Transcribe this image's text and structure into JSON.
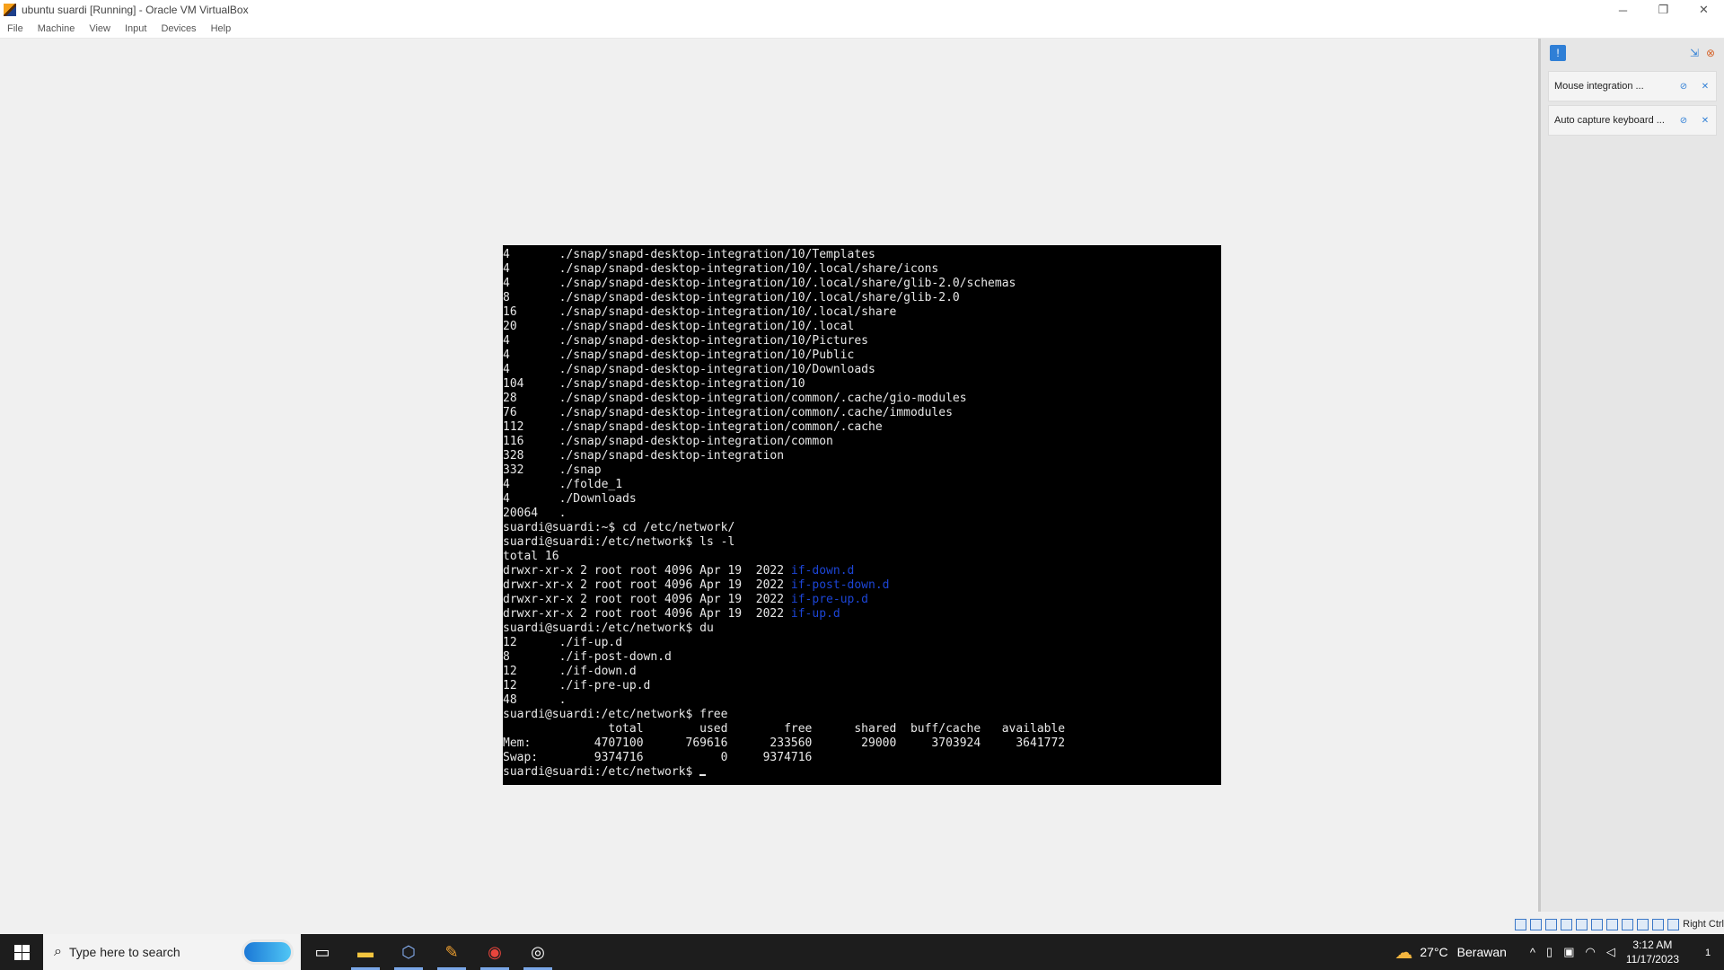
{
  "window": {
    "title": "ubuntu suardi [Running] - Oracle VM VirtualBox",
    "minimize": "─",
    "restore": "❐",
    "close": "✕"
  },
  "menu": [
    "File",
    "Machine",
    "View",
    "Input",
    "Devices",
    "Help"
  ],
  "terminal": {
    "lines": [
      {
        "text": "4       ./snap/snapd-desktop-integration/10/Templates"
      },
      {
        "text": "4       ./snap/snapd-desktop-integration/10/.local/share/icons"
      },
      {
        "text": "4       ./snap/snapd-desktop-integration/10/.local/share/glib-2.0/schemas"
      },
      {
        "text": "8       ./snap/snapd-desktop-integration/10/.local/share/glib-2.0"
      },
      {
        "text": "16      ./snap/snapd-desktop-integration/10/.local/share"
      },
      {
        "text": "20      ./snap/snapd-desktop-integration/10/.local"
      },
      {
        "text": "4       ./snap/snapd-desktop-integration/10/Pictures"
      },
      {
        "text": "4       ./snap/snapd-desktop-integration/10/Public"
      },
      {
        "text": "4       ./snap/snapd-desktop-integration/10/Downloads"
      },
      {
        "text": "104     ./snap/snapd-desktop-integration/10"
      },
      {
        "text": "28      ./snap/snapd-desktop-integration/common/.cache/gio-modules"
      },
      {
        "text": "76      ./snap/snapd-desktop-integration/common/.cache/immodules"
      },
      {
        "text": "112     ./snap/snapd-desktop-integration/common/.cache"
      },
      {
        "text": "116     ./snap/snapd-desktop-integration/common"
      },
      {
        "text": "328     ./snap/snapd-desktop-integration"
      },
      {
        "text": "332     ./snap"
      },
      {
        "text": "4       ./folde_1"
      },
      {
        "text": "4       ./Downloads"
      },
      {
        "text": "20064   ."
      },
      {
        "text": "suardi@suardi:~$ cd /etc/network/"
      },
      {
        "text": "suardi@suardi:/etc/network$ ls -l"
      },
      {
        "text": "total 16"
      },
      {
        "text": "drwxr-xr-x 2 root root 4096 Apr 19  2022 ",
        "dir": "if-down.d"
      },
      {
        "text": "drwxr-xr-x 2 root root 4096 Apr 19  2022 ",
        "dir": "if-post-down.d"
      },
      {
        "text": "drwxr-xr-x 2 root root 4096 Apr 19  2022 ",
        "dir": "if-pre-up.d"
      },
      {
        "text": "drwxr-xr-x 2 root root 4096 Apr 19  2022 ",
        "dir": "if-up.d"
      },
      {
        "text": "suardi@suardi:/etc/network$ du"
      },
      {
        "text": "12      ./if-up.d"
      },
      {
        "text": "8       ./if-post-down.d"
      },
      {
        "text": "12      ./if-down.d"
      },
      {
        "text": "12      ./if-pre-up.d"
      },
      {
        "text": "48      ."
      },
      {
        "text": "suardi@suardi:/etc/network$ free"
      },
      {
        "text": "               total        used        free      shared  buff/cache   available"
      },
      {
        "text": "Mem:         4707100      769616      233560       29000     3703924     3641772"
      },
      {
        "text": "Swap:        9374716           0     9374716"
      },
      {
        "text": "suardi@suardi:/etc/network$ ",
        "cursor": true
      }
    ]
  },
  "side_panel": {
    "notifications": [
      {
        "label": "Mouse integration ..."
      },
      {
        "label": "Auto capture keyboard ..."
      }
    ]
  },
  "statusbar": {
    "host_key": "Right Ctrl"
  },
  "taskbar": {
    "search_placeholder": "Type here to search",
    "weather": {
      "temp": "27°C",
      "condition": "Berawan"
    },
    "clock": {
      "time": "3:12 AM",
      "date": "11/17/2023"
    },
    "notification_count": "1"
  },
  "colors": {
    "terminal_bg": "#000000",
    "dir_color": "#1c45d6",
    "accent": "#2f7fd6"
  }
}
